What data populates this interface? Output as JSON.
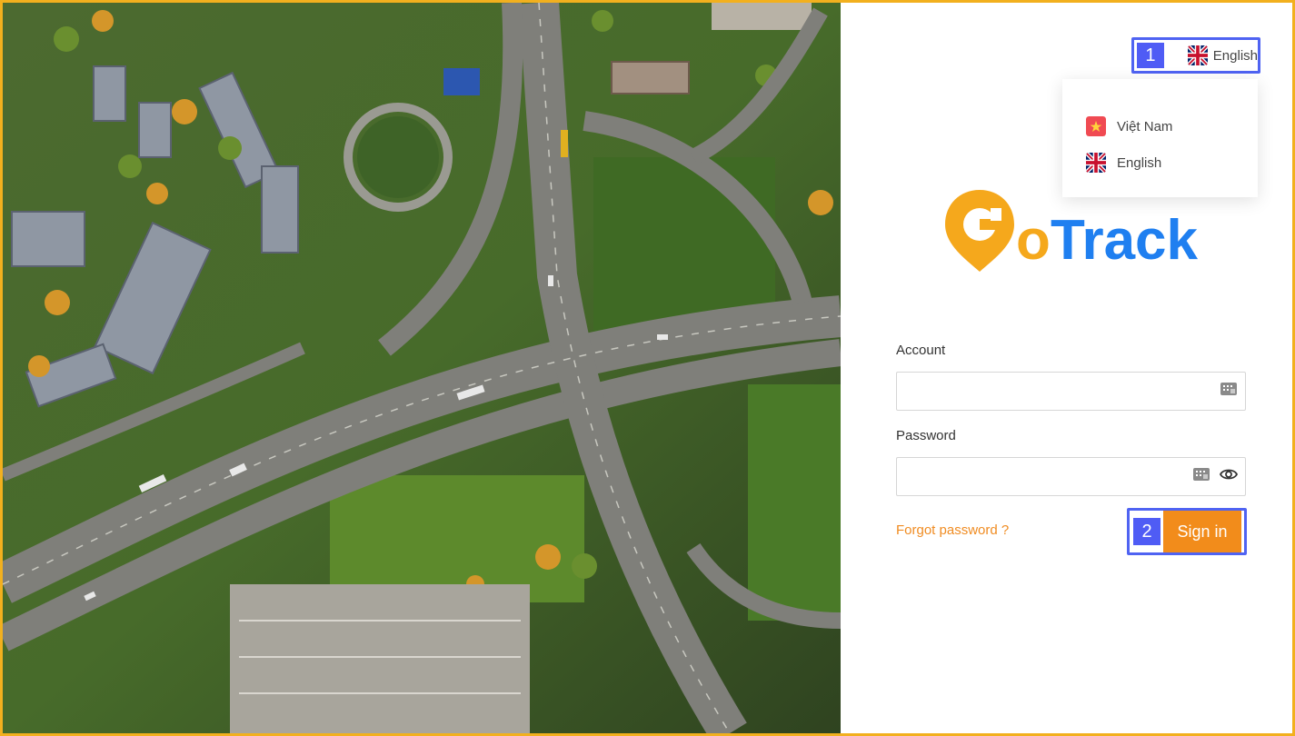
{
  "language_switcher": {
    "callout_number": "1",
    "current_language": "English",
    "flag_icon": "uk-flag-icon"
  },
  "language_menu": {
    "options": [
      {
        "label": "Việt Nam",
        "flag_icon": "vietnam-flag-icon"
      },
      {
        "label": "English",
        "flag_icon": "uk-flag-icon"
      }
    ]
  },
  "brand": {
    "logo_letter": "G",
    "logo_text_orange": "o",
    "logo_text_blue": "Track",
    "colors": {
      "orange": "#f5a81c",
      "blue": "#1f7ff0",
      "accent": "#f28c1b",
      "callout": "#4f5cf5",
      "frame": "#f2b01e"
    }
  },
  "login_form": {
    "account_label": "Account",
    "account_value": "",
    "password_label": "Password",
    "password_value": "",
    "forgot_password": "Forgot password ?",
    "sign_in_callout_number": "2",
    "sign_in": "Sign in"
  }
}
